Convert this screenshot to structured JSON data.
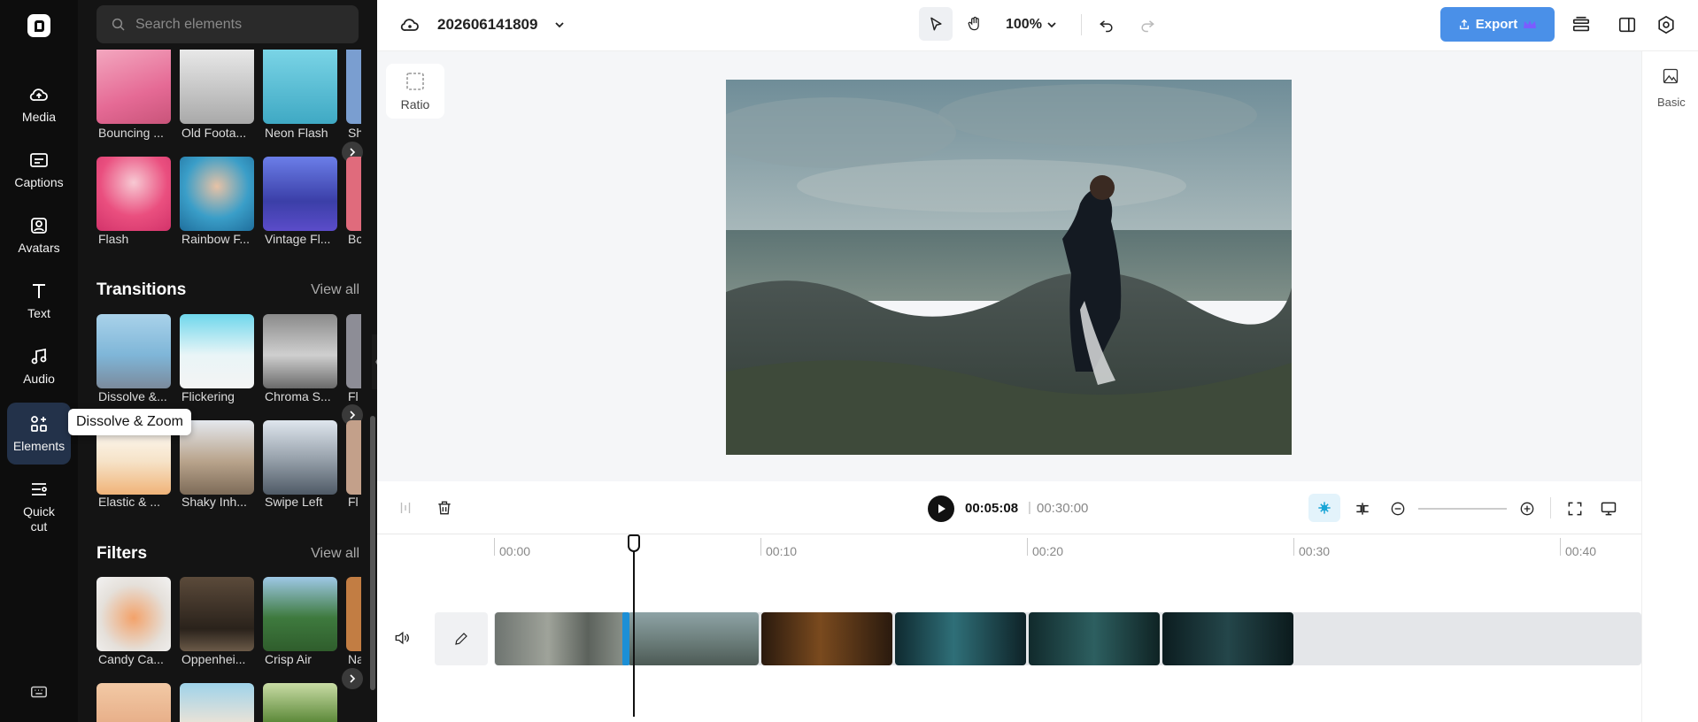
{
  "rail": {
    "items": [
      {
        "label": "Media",
        "icon": "cloud-upload-icon"
      },
      {
        "label": "Captions",
        "icon": "captions-icon"
      },
      {
        "label": "Avatars",
        "icon": "avatar-icon"
      },
      {
        "label": "Text",
        "icon": "text-icon"
      },
      {
        "label": "Audio",
        "icon": "music-icon"
      },
      {
        "label": "Elements",
        "icon": "elements-icon"
      },
      {
        "label": "Quick\ncut",
        "icon": "quick-cut-icon"
      }
    ]
  },
  "panel": {
    "search_placeholder": "Search elements",
    "effects_row1": [
      "Bouncing ...",
      "Old Foota...",
      "Neon Flash",
      "Sh"
    ],
    "effects_row2": [
      "Flash",
      "Rainbow F...",
      "Vintage Fl...",
      "Bo"
    ],
    "transitions": {
      "title": "Transitions",
      "view_all": "View all",
      "row1": [
        "Dissolve &...",
        "Flickering",
        "Chroma S...",
        "Fl"
      ],
      "row2": [
        "Elastic & ...",
        "Shaky Inh...",
        "Swipe Left",
        "Fl"
      ]
    },
    "filters": {
      "title": "Filters",
      "view_all": "View all",
      "row1": [
        "Candy Ca...",
        "Oppenhei...",
        "Crisp Air",
        "Na"
      ]
    },
    "tooltip": "Dissolve & Zoom"
  },
  "topbar": {
    "project_name": "202606141809",
    "zoom": "100%",
    "export_label": "Export"
  },
  "canvas": {
    "ratio_label": "Ratio"
  },
  "right_rail": {
    "basic_label": "Basic"
  },
  "playback": {
    "current_time": "00:05:08",
    "separator": "|",
    "total_time": "00:30:00"
  },
  "timeline": {
    "ticks": [
      "00:00",
      "00:10",
      "00:20",
      "00:30",
      "00:40"
    ]
  },
  "colors": {
    "accent": "#4a90e8",
    "rail_bg": "#0d0d0d",
    "panel_bg": "#141414"
  }
}
